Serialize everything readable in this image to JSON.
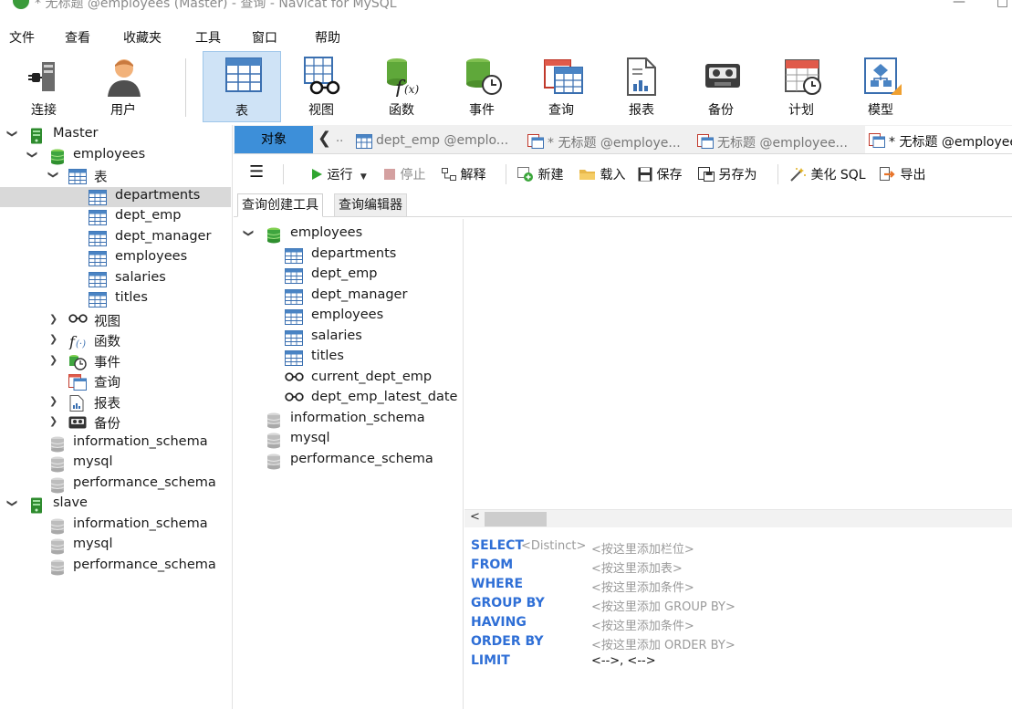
{
  "window": {
    "title": "* 无标题 @employees (Master) - 查询 - Navicat for MySQL",
    "controls": [
      "—",
      "□"
    ]
  },
  "menu": [
    "文件",
    "查看",
    "收藏夹",
    "工具",
    "窗口",
    "帮助"
  ],
  "toolbar": [
    {
      "label": "连接",
      "icon": "plug-icon"
    },
    {
      "label": "用户",
      "icon": "user-icon"
    },
    {
      "label": "表",
      "icon": "table-icon",
      "active": true
    },
    {
      "label": "视图",
      "icon": "glasses-icon"
    },
    {
      "label": "函数",
      "icon": "function-icon"
    },
    {
      "label": "事件",
      "icon": "event-clock-icon"
    },
    {
      "label": "查询",
      "icon": "query-icon"
    },
    {
      "label": "报表",
      "icon": "report-icon"
    },
    {
      "label": "备份",
      "icon": "backup-icon"
    },
    {
      "label": "计划",
      "icon": "calendar-icon"
    },
    {
      "label": "模型",
      "icon": "model-icon"
    }
  ],
  "left_tree": [
    {
      "label": "Master",
      "level": 0,
      "expander": "open",
      "icon": "server"
    },
    {
      "label": "employees",
      "level": 1,
      "expander": "open",
      "icon": "database-green"
    },
    {
      "label": "表",
      "level": 2,
      "expander": "open",
      "icon": "table"
    },
    {
      "label": "departments",
      "level": 3,
      "icon": "table",
      "selected": true
    },
    {
      "label": "dept_emp",
      "level": 3,
      "icon": "table"
    },
    {
      "label": "dept_manager",
      "level": 3,
      "icon": "table"
    },
    {
      "label": "employees",
      "level": 3,
      "icon": "table"
    },
    {
      "label": "salaries",
      "level": 3,
      "icon": "table"
    },
    {
      "label": "titles",
      "level": 3,
      "icon": "table"
    },
    {
      "label": "视图",
      "level": 2,
      "expander": "closed",
      "icon": "view"
    },
    {
      "label": "函数",
      "level": 2,
      "expander": "closed",
      "icon": "function"
    },
    {
      "label": "事件",
      "level": 2,
      "expander": "closed",
      "icon": "event"
    },
    {
      "label": "查询",
      "level": 2,
      "icon": "query"
    },
    {
      "label": "报表",
      "level": 2,
      "expander": "closed",
      "icon": "report"
    },
    {
      "label": "备份",
      "level": 2,
      "expander": "closed",
      "icon": "backup"
    },
    {
      "label": "information_schema",
      "level": 1,
      "icon": "database-gray"
    },
    {
      "label": "mysql",
      "level": 1,
      "icon": "database-gray"
    },
    {
      "label": "performance_schema",
      "level": 1,
      "icon": "database-gray"
    },
    {
      "label": "slave",
      "level": 0,
      "expander": "open",
      "icon": "server"
    },
    {
      "label": "information_schema",
      "level": 1,
      "icon": "database-gray"
    },
    {
      "label": "mysql",
      "level": 1,
      "icon": "database-gray"
    },
    {
      "label": "performance_schema",
      "level": 1,
      "icon": "database-gray"
    }
  ],
  "tabs": {
    "objects_label": "对象",
    "nav_left": "❮",
    "overflow": "..",
    "documents": [
      {
        "label": "dept_emp @emplo...",
        "icon": "table"
      },
      {
        "label": "* 无标题 @employe...",
        "icon": "query"
      },
      {
        "label": "无标题 @employee...",
        "icon": "query"
      },
      {
        "label": "* 无标题 @employees",
        "icon": "query",
        "active": true
      }
    ]
  },
  "query_toolbar": {
    "menu_icon": "☰",
    "run": "运行",
    "stop": "停止",
    "explain": "解释",
    "new": "新建",
    "load": "载入",
    "save": "保存",
    "save_as": "另存为",
    "beautify": "美化 SQL",
    "export": "导出"
  },
  "sub_tabs": [
    "查询创建工具",
    "查询编辑器"
  ],
  "qb_tree": [
    {
      "label": "employees",
      "level": 0,
      "expander": "open",
      "icon": "database-green"
    },
    {
      "label": "departments",
      "level": 1,
      "icon": "table"
    },
    {
      "label": "dept_emp",
      "level": 1,
      "icon": "table"
    },
    {
      "label": "dept_manager",
      "level": 1,
      "icon": "table"
    },
    {
      "label": "employees",
      "level": 1,
      "icon": "table"
    },
    {
      "label": "salaries",
      "level": 1,
      "icon": "table"
    },
    {
      "label": "titles",
      "level": 1,
      "icon": "table"
    },
    {
      "label": "current_dept_emp",
      "level": 1,
      "icon": "view"
    },
    {
      "label": "dept_emp_latest_date",
      "level": 1,
      "icon": "view"
    },
    {
      "label": "information_schema",
      "level": 0,
      "icon": "database-gray"
    },
    {
      "label": "mysql",
      "level": 0,
      "icon": "database-gray"
    },
    {
      "label": "performance_schema",
      "level": 0,
      "icon": "database-gray"
    }
  ],
  "scroll_left": "<",
  "sql": [
    {
      "keyword": "SELECT",
      "distinct": "<Distinct>",
      "placeholder": "<按这里添加栏位>"
    },
    {
      "keyword": "FROM",
      "placeholder": "<按这里添加表>"
    },
    {
      "keyword": "WHERE",
      "placeholder": "<按这里添加条件>"
    },
    {
      "keyword": "GROUP BY",
      "placeholder": "<按这里添加 GROUP BY>"
    },
    {
      "keyword": "HAVING",
      "placeholder": "<按这里添加条件>"
    },
    {
      "keyword": "ORDER BY",
      "placeholder": "<按这里添加 ORDER BY>"
    },
    {
      "keyword": "LIMIT",
      "value": "<-->, <-->"
    }
  ],
  "colors": {
    "accent": "#3d8fd9",
    "keyword": "#2f6fd6",
    "placeholder": "#9a9a9a",
    "db_green": "#3a9b3a",
    "selected_row": "#d9d9d9",
    "active_toolbar": "#cfe3f6"
  }
}
